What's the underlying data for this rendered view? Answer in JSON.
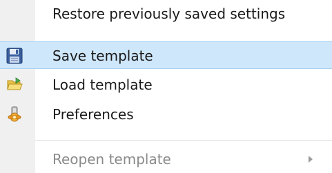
{
  "menu": {
    "items": [
      {
        "label": "Restore previously saved settings",
        "icon": "none",
        "enabled": true,
        "highlighted": false
      },
      {
        "label": "Save template",
        "icon": "floppy-disk-icon",
        "enabled": true,
        "highlighted": true
      },
      {
        "label": "Load template",
        "icon": "open-folder-icon",
        "enabled": true,
        "highlighted": false
      },
      {
        "label": "Preferences",
        "icon": "preferences-icon",
        "enabled": true,
        "highlighted": false
      },
      {
        "label": "Reopen template",
        "icon": "none",
        "enabled": false,
        "highlighted": false,
        "has_submenu": true
      }
    ]
  },
  "colors": {
    "highlight_background": "#cfe7fb",
    "highlight_border": "#a9d2f5",
    "icon_strip": "#f0f0f0",
    "disabled_text": "#8a8a8a"
  }
}
